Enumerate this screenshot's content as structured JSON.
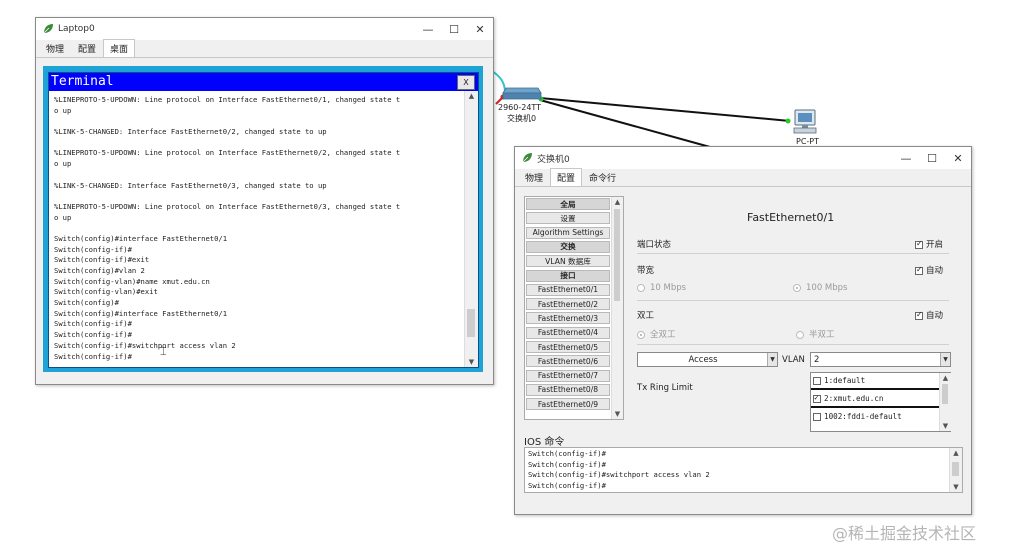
{
  "laptop": {
    "title": "Laptop0",
    "tabs": [
      "物理",
      "配置",
      "桌面"
    ],
    "terminal_title": "Terminal",
    "close": "X",
    "lines": [
      "%LINEPROTO-5-UPDOWN: Line protocol on Interface FastEthernet0/1, changed state t",
      "o up",
      "",
      "%LINK-5-CHANGED: Interface FastEthernet0/2, changed state to up",
      "",
      "%LINEPROTO-5-UPDOWN: Line protocol on Interface FastEthernet0/2, changed state t",
      "o up",
      "",
      "%LINK-5-CHANGED: Interface FastEthernet0/3, changed state to up",
      "",
      "%LINEPROTO-5-UPDOWN: Line protocol on Interface FastEthernet0/3, changed state t",
      "o up",
      "",
      "Switch(config)#interface FastEthernet0/1",
      "Switch(config-if)#",
      "Switch(config-if)#exit",
      "Switch(config)#vlan 2",
      "Switch(config-vlan)#name xmut.edu.cn",
      "Switch(config-vlan)#exit",
      "Switch(config)#",
      "Switch(config)#interface FastEthernet0/1",
      "Switch(config-if)#",
      "Switch(config-if)#",
      "Switch(config-if)#switchport access vlan 2",
      "Switch(config-if)#"
    ]
  },
  "topology": {
    "switch_model": "2960-24TT",
    "switch_name": "交换机0",
    "pc_label": "PC-PT"
  },
  "switch_window": {
    "title": "交换机0",
    "tabs": [
      "物理",
      "配置",
      "命令行"
    ],
    "nav": [
      {
        "label": "全局",
        "header": true
      },
      {
        "label": "设置",
        "header": false
      },
      {
        "label": "Algorithm Settings",
        "header": false
      },
      {
        "label": "交换",
        "header": true
      },
      {
        "label": "VLAN 数据库",
        "header": false
      },
      {
        "label": "接口",
        "header": true
      },
      {
        "label": "FastEthernet0/1",
        "header": false
      },
      {
        "label": "FastEthernet0/2",
        "header": false
      },
      {
        "label": "FastEthernet0/3",
        "header": false
      },
      {
        "label": "FastEthernet0/4",
        "header": false
      },
      {
        "label": "FastEthernet0/5",
        "header": false
      },
      {
        "label": "FastEthernet0/6",
        "header": false
      },
      {
        "label": "FastEthernet0/7",
        "header": false
      },
      {
        "label": "FastEthernet0/8",
        "header": false
      },
      {
        "label": "FastEthernet0/9",
        "header": false
      }
    ],
    "panel_title": "FastEthernet0/1",
    "port_status": {
      "label": "端口状态",
      "check_label": "开启",
      "checked": true
    },
    "bandwidth": {
      "label": "带宽",
      "check_label": "自动",
      "checked": true,
      "opt1": "10 Mbps",
      "opt2": "100 Mbps"
    },
    "duplex": {
      "label": "双工",
      "check_label": "自动",
      "checked": true,
      "opt1": "全双工",
      "opt2": "半双工"
    },
    "mode_select": "Access",
    "vlan_label": "VLAN",
    "vlan_value": "2",
    "vlan_options": [
      {
        "label": "1:default",
        "checked": false
      },
      {
        "label": "2:xmut.edu.cn",
        "checked": true
      },
      {
        "label": "1002:fddi-default",
        "checked": false
      }
    ],
    "tx_ring": "Tx Ring Limit",
    "ios_label": "IOS 命令",
    "ios_lines": [
      "Switch(config-if)#",
      "Switch(config-if)#",
      "Switch(config-if)#switchport access vlan 2",
      "Switch(config-if)#"
    ]
  },
  "watermark": "@稀土掘金技术社区",
  "colors": {
    "terminal_title_bg": "#0000ff",
    "terminal_frame": "#1fa3d6",
    "link_black": "#111111",
    "link_cyan": "#35c4c4"
  }
}
